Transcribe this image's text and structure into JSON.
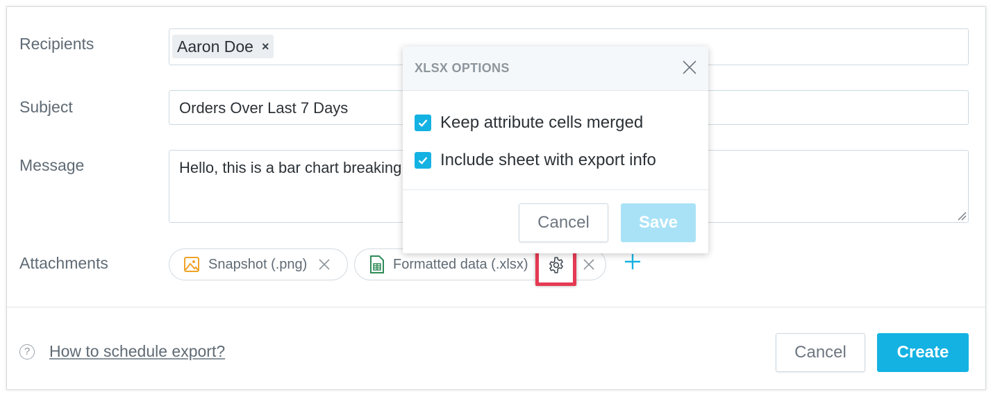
{
  "form": {
    "recipients_label": "Recipients",
    "recipients": [
      {
        "name": "Aaron Doe",
        "remove": "×"
      }
    ],
    "subject_label": "Subject",
    "subject_value": "Orders Over Last 7 Days",
    "message_label": "Message",
    "message_value": "Hello, this is a bar chart breaking",
    "attachments_label": "Attachments",
    "attachments": [
      {
        "name": "Snapshot (.png)",
        "icon": "image-icon"
      },
      {
        "name": "Formatted data (.xlsx)",
        "icon": "spreadsheet-icon"
      }
    ]
  },
  "footer": {
    "help_icon": "?",
    "help_link": "How to schedule export?",
    "cancel_label": "Cancel",
    "create_label": "Create"
  },
  "dialog": {
    "title": "XLSX OPTIONS",
    "options": [
      {
        "label": "Keep attribute cells merged",
        "checked": true
      },
      {
        "label": "Include sheet with export info",
        "checked": true
      }
    ],
    "cancel_label": "Cancel",
    "save_label": "Save"
  },
  "colors": {
    "accent": "#14b2e2",
    "accent_disabled": "#a9e2f6",
    "highlight": "#e53a53",
    "image_icon": "#f0a228",
    "spreadsheet_icon": "#2e8b57"
  }
}
